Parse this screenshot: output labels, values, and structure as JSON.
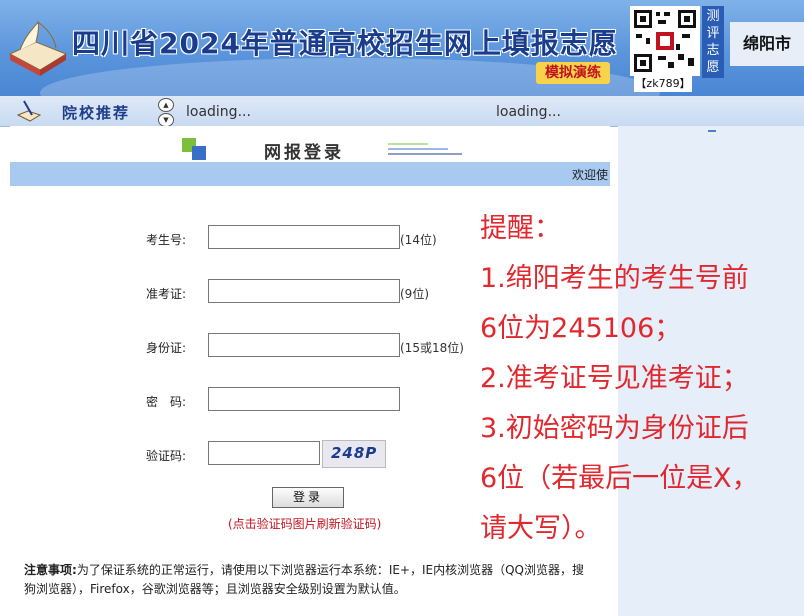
{
  "banner": {
    "title": "四川省2024年普通高校招生网上填报志愿",
    "badge": "模拟演练",
    "qr_code_label": "【zk789】",
    "vertical_text": "测评志愿",
    "city": "绵阳市"
  },
  "nav": {
    "title": "院校推荐",
    "loading_left": "loading...",
    "loading_right": "loading..."
  },
  "login": {
    "title": "网报登录",
    "welcome": "欢迎使",
    "fields": [
      {
        "label": "考生号:",
        "value": "",
        "hint": "(14位)"
      },
      {
        "label": "准考证:",
        "value": "",
        "hint": "(9位)"
      },
      {
        "label": "身份证:",
        "value": "",
        "hint": "(15或18位)"
      },
      {
        "label": "密　码:",
        "value": "",
        "hint": ""
      },
      {
        "label": "验证码:",
        "value": "",
        "hint": ""
      }
    ],
    "captcha_text": "248P",
    "button_label": "登录",
    "captcha_note": "(点击验证码图片刷新验证码)"
  },
  "notice": {
    "title": "注意事项:",
    "text": "为了保证系统的正常运行，请使用以下浏览器运行本系统：IE+，IE内核浏览器（QQ浏览器，搜狗浏览器），Firefox，谷歌浏览器等；且浏览器安全级别设置为默认值。"
  },
  "reminder": {
    "lines": [
      "提醒：",
      "1.绵阳考生的考生号前",
      "6位为245106；",
      "2.准考证号见准考证；",
      "3.初始密码为身份证后",
      "6位（若最后一位是X，",
      "请大写）。"
    ]
  },
  "colors": {
    "accent": "#1a3c8c",
    "reminder": "#e0282e",
    "welcome_bar": "#a8caf0"
  }
}
